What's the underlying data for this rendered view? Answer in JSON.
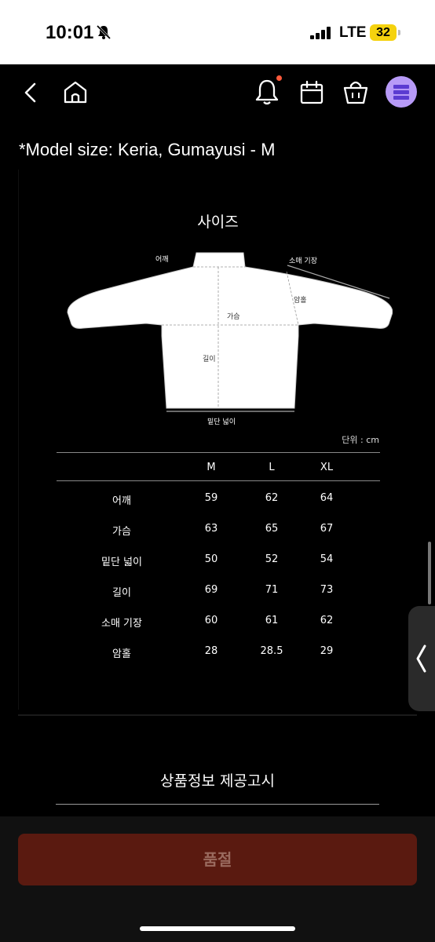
{
  "status_bar": {
    "time": "10:01",
    "network": "LTE",
    "battery": "32"
  },
  "header": {
    "model_size": "*Model size: Keria, Gumayusi - M"
  },
  "size_chart": {
    "title": "사이즈",
    "diagram_labels": {
      "shoulder": "어깨",
      "sleeve_length": "소매 기장",
      "armhole": "암홀",
      "chest": "가슴",
      "length": "길이",
      "hem_width": "밑단 넓이"
    },
    "unit": "단위 : cm",
    "columns": [
      "M",
      "L",
      "XL"
    ],
    "rows": [
      {
        "label": "어깨",
        "M": "59",
        "L": "62",
        "XL": "64"
      },
      {
        "label": "가슴",
        "M": "63",
        "L": "65",
        "XL": "67"
      },
      {
        "label": "밑단 넓이",
        "M": "50",
        "L": "52",
        "XL": "54"
      },
      {
        "label": "길이",
        "M": "69",
        "L": "71",
        "XL": "73"
      },
      {
        "label": "소매 기장",
        "M": "60",
        "L": "61",
        "XL": "62"
      },
      {
        "label": "암홀",
        "M": "28",
        "L": "28.5",
        "XL": "29"
      }
    ]
  },
  "product_info": {
    "title": "상품정보 제공고시"
  },
  "footer": {
    "soldout_label": "품절"
  }
}
